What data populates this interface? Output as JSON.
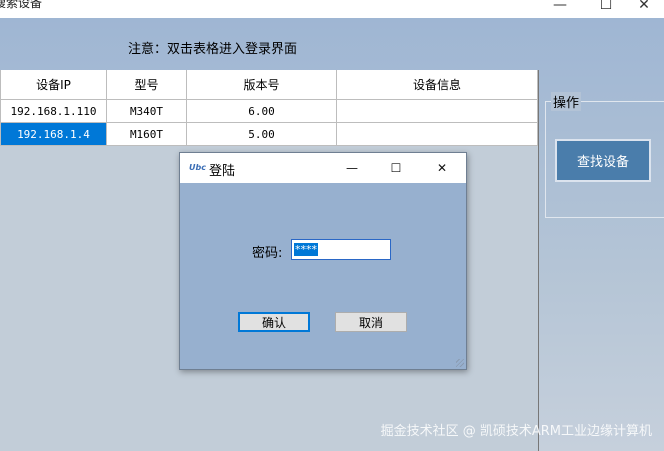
{
  "main_window": {
    "title": "搜索设备",
    "minimize_glyph": "—",
    "maximize_glyph": "☐",
    "close_glyph": "✕"
  },
  "notice": "注意：双击表格进入登录界面",
  "table": {
    "headers": [
      "设备IP",
      "型号",
      "版本号",
      "设备信息"
    ],
    "rows": [
      {
        "ip": "192.168.1.110",
        "model": "M340T",
        "version": "6.00",
        "info": ""
      },
      {
        "ip": "192.168.1.4",
        "model": "M160T",
        "version": "5.00",
        "info": ""
      }
    ],
    "selected_row": 1
  },
  "operations": {
    "group_label": "操作",
    "find_button": "查找设备"
  },
  "login_dialog": {
    "title": "登陆",
    "icon_text": "Ubc",
    "minimize_glyph": "—",
    "maximize_glyph": "☐",
    "close_glyph": "✕",
    "password_label": "密码:",
    "password_value": "****",
    "ok_button": "确认",
    "cancel_button": "取消"
  },
  "watermark": "掘金技术社区 @ 凯硕技术ARM工业边缘计算机"
}
